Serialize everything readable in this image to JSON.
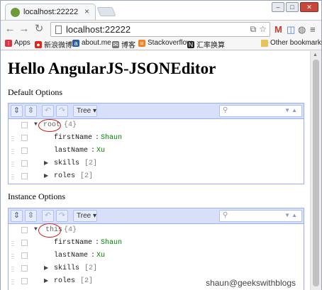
{
  "browser": {
    "tab_title": "localhost:22222",
    "url": "localhost:22222",
    "bookmarks": [
      "Apps",
      "新浪微博",
      "about.me",
      "博客",
      "Stackoverflow",
      "汇率换算",
      "Other bookmarks"
    ]
  },
  "page": {
    "title": "Hello AngularJS-JSONEditor",
    "watermark": "shaun@geekswithblogs"
  },
  "editors": [
    {
      "heading": "Default Options",
      "mode": "Tree",
      "root": {
        "name": "root",
        "count": "{4}"
      },
      "rows": [
        {
          "key": "firstName",
          "sep": ":",
          "value": "Shaun"
        },
        {
          "key": "lastName",
          "sep": ":",
          "value": "Xu"
        },
        {
          "key": "skills",
          "count": "[2]"
        },
        {
          "key": "roles",
          "count": "[2]"
        }
      ]
    },
    {
      "heading": "Instance Options",
      "mode": "Tree",
      "root": {
        "name": "this",
        "count": "{4}"
      },
      "rows": [
        {
          "key": "firstName",
          "sep": ":",
          "value": "Shaun"
        },
        {
          "key": "lastName",
          "sep": ":",
          "value": "Xu"
        },
        {
          "key": "skills",
          "count": "[2]"
        },
        {
          "key": "roles",
          "count": "[2]"
        }
      ]
    }
  ]
}
